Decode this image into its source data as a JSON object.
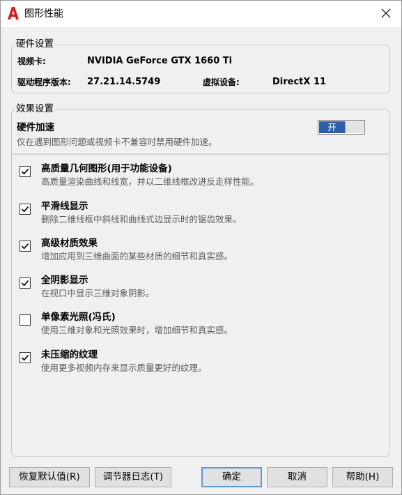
{
  "window": {
    "title": "图形性能",
    "close_glyph": "✕",
    "logo_letter": "A"
  },
  "hardware": {
    "caption": "硬件设置",
    "video_card_label": "视频卡:",
    "video_card_value": "NVIDIA GeForce GTX 1660 Ti",
    "driver_label": "驱动程序版本:",
    "driver_value": "27.21.14.5749",
    "virtual_device_label": "虚拟设备:",
    "virtual_device_value": "DirectX 11"
  },
  "effects": {
    "caption": "效果设置",
    "hw_accel_title": "硬件加速",
    "hw_accel_desc": "仅在遇到图形问题或视频卡不兼容时禁用硬件加速。",
    "toggle_label": "开",
    "toggle_state": "on",
    "options": [
      {
        "title": "高质量几何图形(用于功能设备)",
        "desc": "高质量渲染曲线和线宽，并以二维线框改进反走样性能。",
        "checked": true
      },
      {
        "title": "平滑线显示",
        "desc": "删除二维线框中斜线和曲线式边显示时的锯齿效果。",
        "checked": true
      },
      {
        "title": "高级材质效果",
        "desc": "增加应用到三维曲面的某些材质的细节和真实感。",
        "checked": true
      },
      {
        "title": "全阴影显示",
        "desc": "在视口中显示三维对象阴影。",
        "checked": true
      },
      {
        "title": "单像素光照(冯氏)",
        "desc": "使用三维对象和光照效果时，增加细节和真实感。",
        "checked": false
      },
      {
        "title": "未压缩的纹理",
        "desc": "使用更多视频内存来显示质量更好的纹理。",
        "checked": true
      }
    ]
  },
  "buttons": {
    "restore_defaults": "恢复默认值(R)",
    "tuner_log": "调节器日志(T)",
    "ok": "确定",
    "cancel": "取消",
    "help": "帮助(H)"
  },
  "colors": {
    "accent": "#2f5fa7",
    "logo_red": "#d71920",
    "default_button_border": "#5b9bd5"
  }
}
